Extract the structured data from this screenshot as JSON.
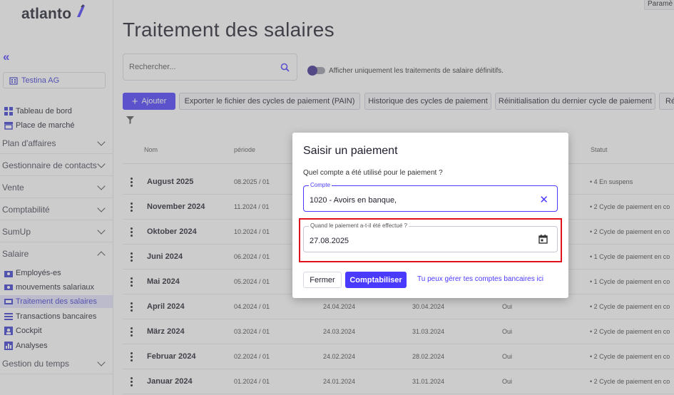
{
  "app": {
    "logo": "atlanto",
    "top_right": "Paramè"
  },
  "sidebar": {
    "company": "Testina AG",
    "links_top": [
      "Tableau de bord",
      "Place de marché"
    ],
    "sections": [
      "Plan d'affaires",
      "Gestionnaire de contacts",
      "Vente",
      "Comptabilité",
      "SumUp",
      "Salaire"
    ],
    "salary_items": [
      "Employés-es",
      "mouvements salariaux",
      "Traitement des salaires",
      "Transactions bancaires",
      "Cockpit",
      "Analyses"
    ],
    "bottom_section": "Gestion du temps"
  },
  "page": {
    "title": "Traitement des salaires",
    "search_placeholder": "Rechercher...",
    "toggle_label": "Afficher uniquement les traitements de salaire définitifs.",
    "buttons": {
      "add": "Ajouter",
      "export": "Exporter le fichier des cycles de paiement (PAIN)",
      "history": "Historique des cycles de paiement",
      "reset": "Réinitialisation du dernier cycle de paiement",
      "more": "Ré"
    }
  },
  "table": {
    "headers": {
      "nom": "Nom",
      "periode": "période",
      "statut": "Statut"
    },
    "rows": [
      {
        "nom": "August 2025",
        "periode": "08.2025 / 01",
        "d1": "",
        "d2": "",
        "final": "",
        "statut": "4 En suspens"
      },
      {
        "nom": "November 2024",
        "periode": "11.2024 / 01",
        "d1": "",
        "d2": "",
        "final": "",
        "statut": "2 Cycle de paiement en co"
      },
      {
        "nom": "Oktober 2024",
        "periode": "10.2024 / 01",
        "d1": "",
        "d2": "",
        "final": "",
        "statut": "2 Cycle de paiement en co"
      },
      {
        "nom": "Juni 2024",
        "periode": "06.2024 / 01",
        "d1": "",
        "d2": "",
        "final": "",
        "statut": "1 Cycle de paiement en co"
      },
      {
        "nom": "Mai 2024",
        "periode": "05.2024 / 01",
        "d1": "",
        "d2": "",
        "final": "",
        "statut": "1 Cycle de paiement en co"
      },
      {
        "nom": "April 2024",
        "periode": "04.2024 / 01",
        "d1": "24.04.2024",
        "d2": "30.04.2024",
        "final": "Oui",
        "statut": "2 Cycle de paiement en co"
      },
      {
        "nom": "März 2024",
        "periode": "03.2024 / 01",
        "d1": "24.03.2024",
        "d2": "31.03.2024",
        "final": "Oui",
        "statut": "2 Cycle de paiement en co"
      },
      {
        "nom": "Februar 2024",
        "periode": "02.2024 / 01",
        "d1": "24.02.2024",
        "d2": "28.02.2024",
        "final": "Oui",
        "statut": "2 Cycle de paiement en co"
      },
      {
        "nom": "Januar 2024",
        "periode": "01.2024 / 01",
        "d1": "24.01.2024",
        "d2": "31.01.2024",
        "final": "Oui",
        "statut": "2 Cycle de paiement en co"
      }
    ]
  },
  "modal": {
    "title": "Saisir un paiement",
    "question": "Quel compte a été utilisé pour le paiement ?",
    "account_label": "Compte",
    "account_value": "1020 - Avoirs en banque,",
    "date_label": "Quand le paiement a-t-il été effectué ?",
    "date_value": "27.08.2025",
    "btn_close": "Fermer",
    "btn_submit": "Comptabiliser",
    "bank_link": "Tu peux gérer tes comptes bancaires ici"
  },
  "colors": {
    "accent": "#4a3aff",
    "highlight": "#e0121c"
  }
}
